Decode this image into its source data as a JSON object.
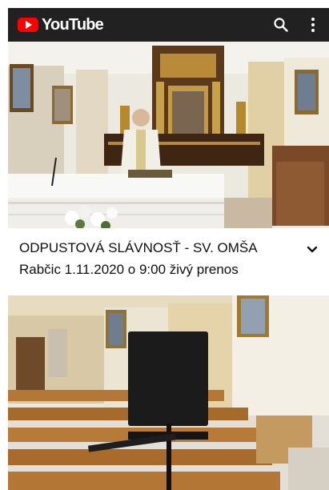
{
  "app": {
    "name": "YouTube"
  },
  "toolbar": {
    "search_icon": "search-icon",
    "more_icon": "more-vert-icon"
  },
  "video1": {
    "title": "ODPUSTOVÁ SLÁVNOSŤ - SV. OMŠA",
    "subtitle": "Rabčic 1.11.2020 o 9:00 živý prenos",
    "expand_icon": "chevron-down-icon"
  },
  "colors": {
    "appbar": "#212121",
    "brand_red": "#ff0000",
    "text": "#0f0f0f"
  }
}
